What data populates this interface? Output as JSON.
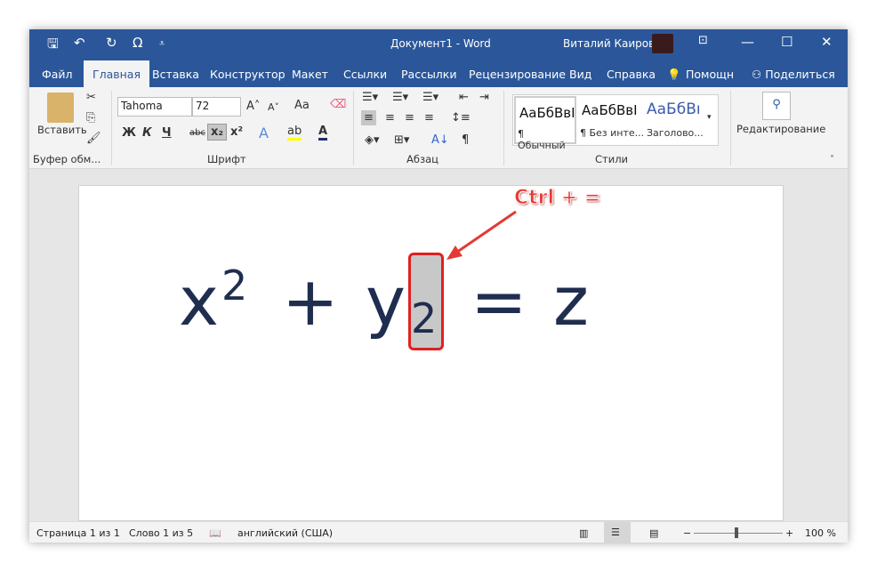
{
  "window": {
    "title": "Документ1 - Word",
    "user": "Виталий Каиров"
  },
  "qat": {
    "save": "🖫",
    "undo": "↶",
    "redo": "↻",
    "symbol": "Ω",
    "customize": "⩡"
  },
  "tabs": [
    "Файл",
    "Главная",
    "Вставка",
    "Конструктор",
    "Макет",
    "Ссылки",
    "Рассылки",
    "Рецензирование",
    "Вид",
    "Справка",
    "Помощн",
    "Поделиться"
  ],
  "ribbon": {
    "clipboard": {
      "paste": "Вставить",
      "label": "Буфер обм..."
    },
    "font": {
      "name": "Tahoma",
      "size": "72",
      "label": "Шрифт",
      "bold": "Ж",
      "italic": "К",
      "underline": "Ч",
      "strike": "abc",
      "subscript": "x₂",
      "superscript": "x²",
      "case": "Aa"
    },
    "paragraph": {
      "label": "Абзац"
    },
    "styles": {
      "label": "Стили",
      "items": [
        {
          "sample": "АаБбВвI",
          "name": "¶ Обычный"
        },
        {
          "sample": "АаБбВвI",
          "name": "¶ Без инте..."
        },
        {
          "sample": "АаБбВı",
          "name": "Заголово..."
        }
      ]
    },
    "editing": {
      "label": "Редактирование"
    }
  },
  "document": {
    "x": "x",
    "sup": "2",
    "plus": "+",
    "y": "y",
    "sub": "2",
    "eq": "=",
    "z": "z"
  },
  "annotation": {
    "text": "Ctrl + =",
    "color": "#e53935"
  },
  "status": {
    "page": "Страница 1 из 1",
    "words": "Слово 1 из 5",
    "language": "английский (США)",
    "zoom": "100 %",
    "zoom_minus": "−",
    "zoom_plus": "+"
  },
  "colors": {
    "accent": "#2b579a"
  }
}
